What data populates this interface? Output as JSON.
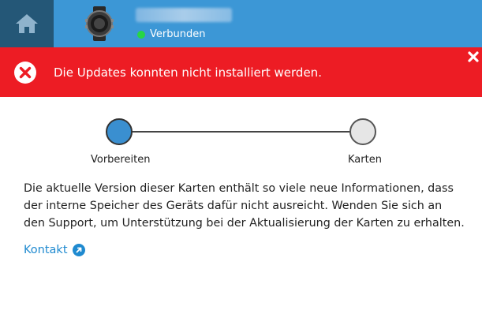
{
  "header": {
    "home_icon": "home-icon",
    "device_icon": "smartwatch-icon",
    "device_name": "",
    "status_text": "Verbunden",
    "status_color": "#27d645",
    "accent": "#3c97d6"
  },
  "error_banner": {
    "icon": "error-x-icon",
    "message": "Die Updates konnten nicht installiert werden.",
    "close_icon": "close-icon",
    "background": "#ed1c24"
  },
  "stepper": {
    "steps": [
      {
        "label": "Vorbereiten",
        "state": "active"
      },
      {
        "label": "Karten",
        "state": "pending"
      }
    ]
  },
  "content": {
    "message": "Die aktuelle Version dieser Karten enthält so viele neue Informationen, dass der interne Speicher des Geräts dafür nicht ausreicht. Wenden Sie sich an den Support, um Unterstützung bei der Aktualisierung der Karten zu erhalten.",
    "link_label": "Kontakt",
    "link_icon": "external-link-icon"
  }
}
